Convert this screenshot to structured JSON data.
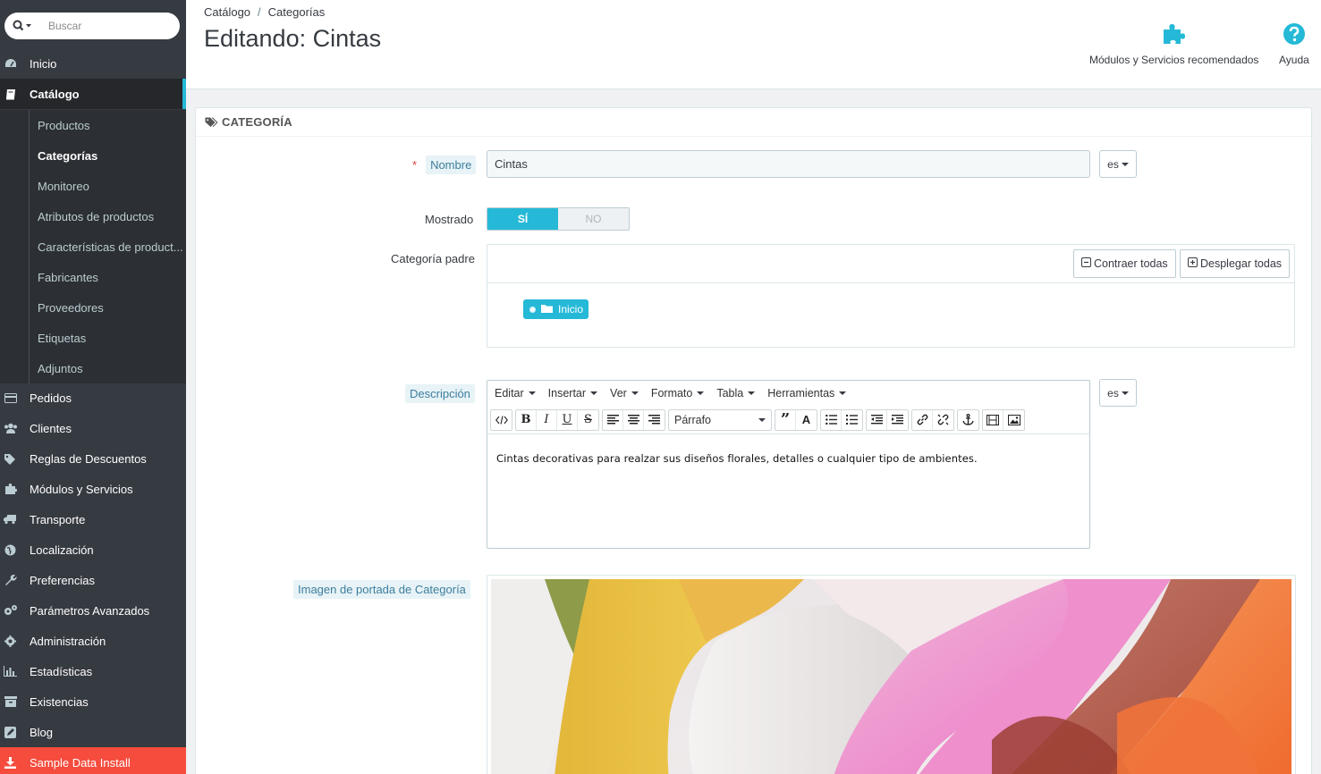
{
  "sidebar": {
    "search_placeholder": "Buscar",
    "items": [
      {
        "label": "Inicio"
      },
      {
        "label": "Catálogo"
      },
      {
        "label": "Pedidos"
      },
      {
        "label": "Clientes"
      },
      {
        "label": "Reglas de Descuentos"
      },
      {
        "label": "Módulos y Servicios"
      },
      {
        "label": "Transporte"
      },
      {
        "label": "Localización"
      },
      {
        "label": "Preferencias"
      },
      {
        "label": "Parámetros Avanzados"
      },
      {
        "label": "Administración"
      },
      {
        "label": "Estadísticas"
      },
      {
        "label": "Existencias"
      },
      {
        "label": "Blog"
      },
      {
        "label": "Sample Data Install"
      }
    ],
    "catalog_sub": [
      {
        "label": "Productos"
      },
      {
        "label": "Categorías"
      },
      {
        "label": "Monitoreo"
      },
      {
        "label": "Atributos de productos"
      },
      {
        "label": "Características de product..."
      },
      {
        "label": "Fabricantes"
      },
      {
        "label": "Proveedores"
      },
      {
        "label": "Etiquetas"
      },
      {
        "label": "Adjuntos"
      }
    ]
  },
  "header": {
    "breadcrumb": [
      "Catálogo",
      "Categorías"
    ],
    "breadcrumb_sep": "/",
    "title": "Editando: Cintas",
    "modules_label": "Módulos y Servicios recomendados",
    "help_label": "Ayuda"
  },
  "panel": {
    "heading": "CATEGORÍA",
    "required_mark": "*",
    "name_label": "Nombre",
    "name_value": "Cintas",
    "lang": "es",
    "shown_label": "Mostrado",
    "switch_on": "SÍ",
    "switch_off": "NO",
    "parent_label": "Categoría padre",
    "collapse_all": "Contraer todas",
    "expand_all": "Desplegar todas",
    "tree_root": "Inicio",
    "description_label": "Descripción",
    "editor_menu": [
      "Editar",
      "Insertar",
      "Ver",
      "Formato",
      "Tabla",
      "Herramientas"
    ],
    "format_select": "Párrafo",
    "description_text": "Cintas decorativas para realzar sus diseños florales, detalles o cualquier tipo de ambientes.",
    "cover_label": "Imagen de portada de Categoría"
  },
  "colors": {
    "accent": "#25b9d7",
    "sidebar_bg": "#363a41",
    "sample_bg": "#f54c3e",
    "required": "#e0413c"
  }
}
